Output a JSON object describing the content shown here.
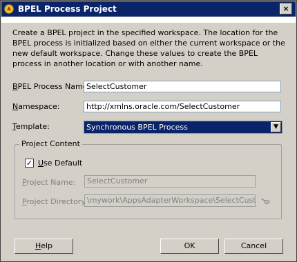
{
  "window": {
    "title": "BPEL Process Project",
    "close_glyph": "×"
  },
  "description": "Create a BPEL project in the specified workspace. The location for the BPEL process is initialized based on either the current workspace or the new default workspace. Change these values to create the BPEL process in another location or with another name.",
  "form": {
    "process_name": {
      "label_mnemonic": "B",
      "label_rest": "PEL Process Name:",
      "value": "SelectCustomer"
    },
    "namespace": {
      "label_mnemonic": "N",
      "label_rest": "amespace:",
      "value": "http://xmlns.oracle.com/SelectCustomer"
    },
    "template": {
      "label_mnemonic": "T",
      "label_rest": "emplate:",
      "value": "Synchronous BPEL Process"
    }
  },
  "project_content": {
    "title": "Project Content",
    "use_default": {
      "label_mnemonic": "U",
      "label_rest": "se Default",
      "checked": true,
      "check_glyph": "✓"
    },
    "project_name": {
      "label_mnemonic": "P",
      "label_rest": "roject Name:",
      "value": "SelectCustomer"
    },
    "project_directory": {
      "label_mnemonic": "P",
      "label_rest": "roject Directory:",
      "value": "\\mywork\\AppsAdapterWorkspace\\SelectCustomer"
    }
  },
  "buttons": {
    "help": {
      "mnemonic": "H",
      "rest": "elp"
    },
    "ok": "OK",
    "cancel": "Cancel"
  },
  "icons": {
    "app": "bpel-app-icon",
    "browse": "flashlight-browse-icon"
  }
}
